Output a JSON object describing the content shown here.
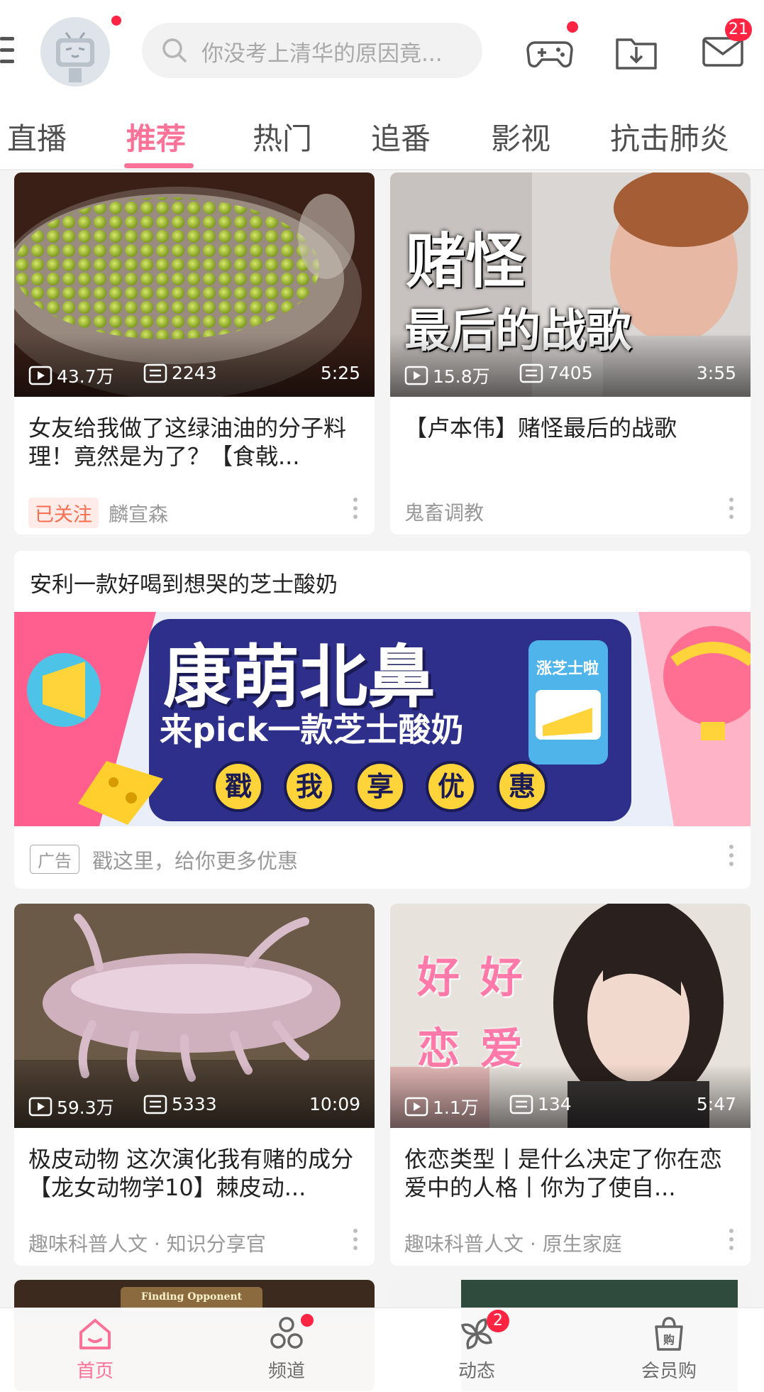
{
  "header": {
    "search_placeholder": "你没考上清华的原因竟...",
    "message_badge": "21"
  },
  "tabs": [
    {
      "label": "直播"
    },
    {
      "label": "推荐",
      "active": true
    },
    {
      "label": "热门"
    },
    {
      "label": "追番"
    },
    {
      "label": "影视"
    },
    {
      "label": "抗击肺炎"
    }
  ],
  "cards": [
    {
      "views": "43.7万",
      "danmaku": "2243",
      "duration": "5:25",
      "title": "女友给我做了这绿油油的分子料理！竟然是为了？【食戟...",
      "follow_tag": "已关注",
      "author": "麟宣森"
    },
    {
      "views": "15.8万",
      "danmaku": "7405",
      "duration": "3:55",
      "title": "【卢本伟】赌怪最后的战歌",
      "thumb_text_1": "赌怪",
      "thumb_text_2": "最后的战歌",
      "author": "鬼畜调教"
    },
    {
      "views": "59.3万",
      "danmaku": "5333",
      "duration": "10:09",
      "title": "极皮动物 这次演化我有赌的成分【龙女动物学10】棘皮动...",
      "author": "趣味科普人文 · 知识分享官"
    },
    {
      "views": "1.1万",
      "danmaku": "134",
      "duration": "5:47",
      "title": "依恋类型丨是什么决定了你在恋爱中的人格丨你为了使自...",
      "thumb_text_1": "好 好",
      "thumb_text_2": "恋 爱",
      "author": "趣味科普人文 · 原生家庭"
    },
    {
      "thumb_text_1": "Finding Opponent"
    }
  ],
  "ad": {
    "title": "安利一款好喝到想哭的芝士酸奶",
    "banner_headline": "康萌北鼻",
    "banner_sub": "来pick一款芝士酸奶",
    "banner_buttons": [
      "戳",
      "我",
      "享",
      "优",
      "惠"
    ],
    "product_label": "涨芝士啦",
    "tag": "广告",
    "subtitle": "戳这里，给你更多优惠"
  },
  "bottom_nav": [
    {
      "label": "首页",
      "icon": "home-icon",
      "active": true
    },
    {
      "label": "频道",
      "icon": "channel-icon"
    },
    {
      "label": "动态",
      "icon": "dynamic-icon",
      "badge": "2"
    },
    {
      "label": "会员购",
      "icon": "shop-bag-icon"
    }
  ],
  "colors": {
    "accent": "#fb7299",
    "badge": "#ff2442"
  }
}
